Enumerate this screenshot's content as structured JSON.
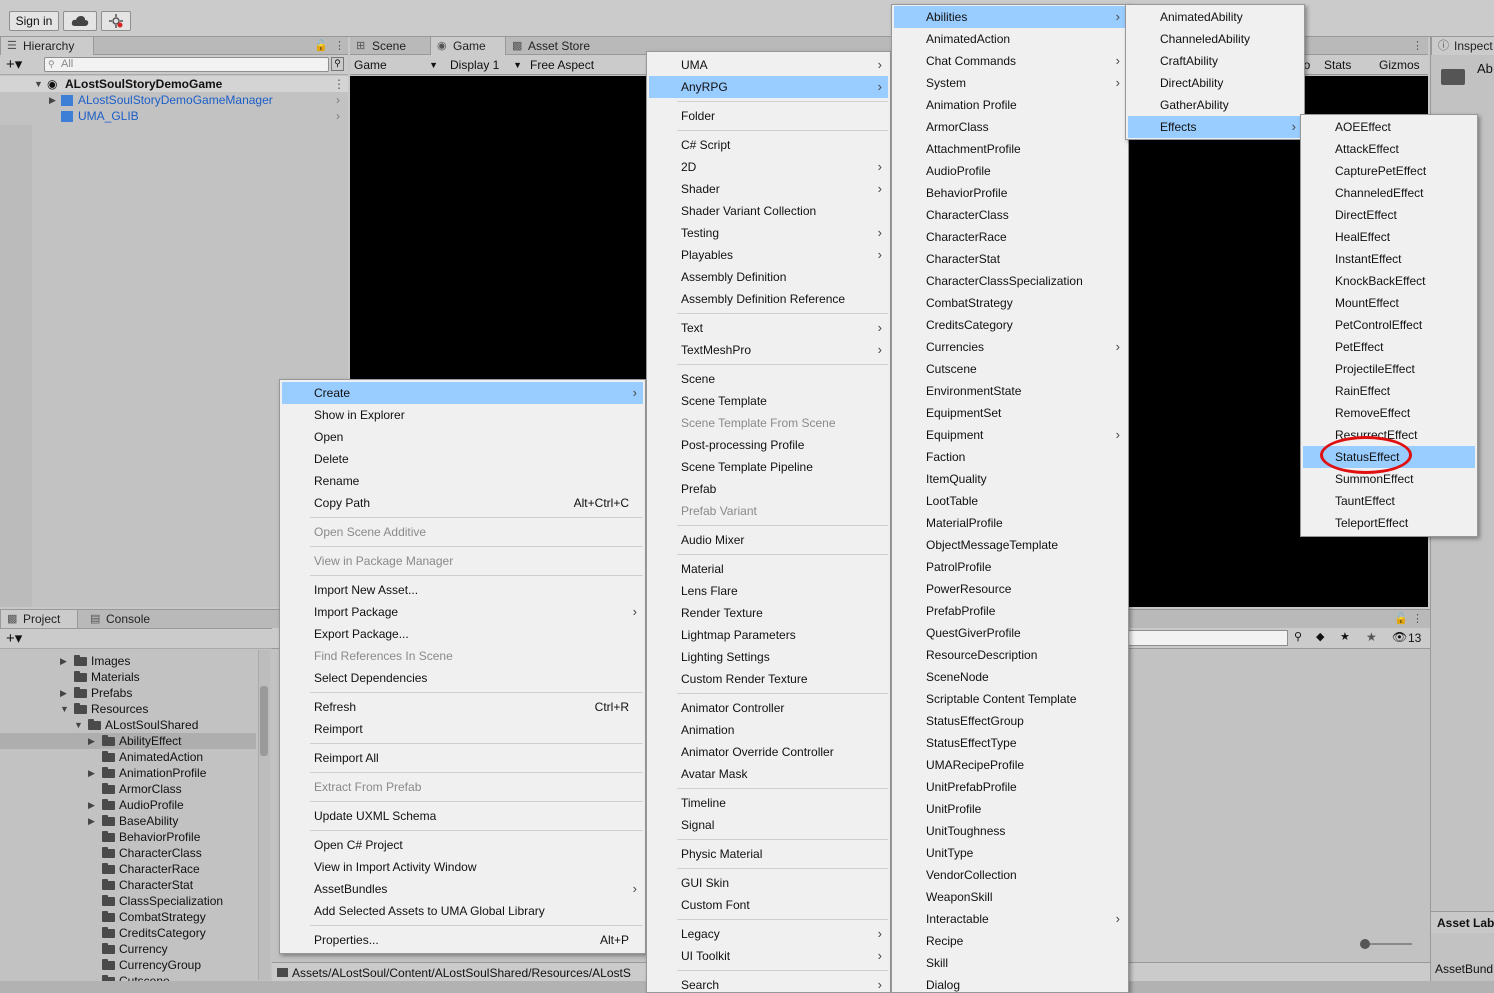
{
  "toolbar": {
    "signin_label": "Sign in",
    "cloud_icon": "cloud-icon",
    "collab_icon": "collab-icon"
  },
  "hierarchy": {
    "tab_label": "Hierarchy",
    "search_placeholder": "All",
    "scene_name": "ALostSoulStoryDemoGame",
    "children": [
      "ALostSoulStoryDemoGameManager",
      "UMA_GLIB"
    ]
  },
  "gameview": {
    "tabs": [
      "Scene",
      "Game",
      "Asset Store"
    ],
    "game_dropdown": "Game",
    "display_dropdown": "Display 1",
    "aspect_dropdown": "Free Aspect",
    "stats_label": "Stats",
    "gizmos_label": "Gizmos",
    "partial_label": "io"
  },
  "inspector": {
    "tab_label": "Inspect",
    "partial_label": "Ab",
    "asset_labels": "Asset Lab",
    "asset_bundle": "AssetBund"
  },
  "project": {
    "tabs": [
      "Project",
      "Console"
    ],
    "tree": [
      {
        "label": "Images",
        "expand": true,
        "indent": 1
      },
      {
        "label": "Materials",
        "expand": false,
        "indent": 1
      },
      {
        "label": "Prefabs",
        "expand": true,
        "indent": 1
      },
      {
        "label": "Resources",
        "expand": true,
        "open": true,
        "indent": 1
      },
      {
        "label": "ALostSoulShared",
        "expand": true,
        "open": true,
        "indent": 2
      },
      {
        "label": "AbilityEffect",
        "expand": true,
        "indent": 3,
        "selected": true
      },
      {
        "label": "AnimatedAction",
        "expand": false,
        "indent": 3
      },
      {
        "label": "AnimationProfile",
        "expand": true,
        "indent": 3
      },
      {
        "label": "ArmorClass",
        "expand": false,
        "indent": 3
      },
      {
        "label": "AudioProfile",
        "expand": true,
        "indent": 3
      },
      {
        "label": "BaseAbility",
        "expand": true,
        "indent": 3
      },
      {
        "label": "BehaviorProfile",
        "expand": false,
        "indent": 3
      },
      {
        "label": "CharacterClass",
        "expand": false,
        "indent": 3
      },
      {
        "label": "CharacterRace",
        "expand": false,
        "indent": 3
      },
      {
        "label": "CharacterStat",
        "expand": false,
        "indent": 3
      },
      {
        "label": "ClassSpecialization",
        "expand": false,
        "indent": 3
      },
      {
        "label": "CombatStrategy",
        "expand": false,
        "indent": 3
      },
      {
        "label": "CreditsCategory",
        "expand": false,
        "indent": 3
      },
      {
        "label": "Currency",
        "expand": false,
        "indent": 3
      },
      {
        "label": "CurrencyGroup",
        "expand": false,
        "indent": 3
      },
      {
        "label": "Cutscene",
        "expand": false,
        "indent": 3
      }
    ],
    "path": "Assets/ALostSoul/Content/ALostSoulShared/Resources/ALostS",
    "hidden_count": "13"
  },
  "menu_main": [
    {
      "label": "Create",
      "sub": true,
      "hl": true
    },
    {
      "label": "Show in Explorer"
    },
    {
      "label": "Open"
    },
    {
      "label": "Delete"
    },
    {
      "label": "Rename"
    },
    {
      "label": "Copy Path",
      "sc": "Alt+Ctrl+C"
    },
    {
      "sep": true
    },
    {
      "label": "Open Scene Additive",
      "dis": true
    },
    {
      "sep": true
    },
    {
      "label": "View in Package Manager",
      "dis": true
    },
    {
      "sep": true
    },
    {
      "label": "Import New Asset..."
    },
    {
      "label": "Import Package",
      "sub": true
    },
    {
      "label": "Export Package..."
    },
    {
      "label": "Find References In Scene",
      "dis": true
    },
    {
      "label": "Select Dependencies"
    },
    {
      "sep": true
    },
    {
      "label": "Refresh",
      "sc": "Ctrl+R"
    },
    {
      "label": "Reimport"
    },
    {
      "sep": true
    },
    {
      "label": "Reimport All"
    },
    {
      "sep": true
    },
    {
      "label": "Extract From Prefab",
      "dis": true
    },
    {
      "sep": true
    },
    {
      "label": "Update UXML Schema"
    },
    {
      "sep": true
    },
    {
      "label": "Open C# Project"
    },
    {
      "label": "View in Import Activity Window"
    },
    {
      "label": "AssetBundles",
      "sub": true
    },
    {
      "label": "Add Selected Assets to UMA Global Library"
    },
    {
      "sep": true
    },
    {
      "label": "Properties...",
      "sc": "Alt+P"
    }
  ],
  "menu_create": [
    {
      "label": "UMA",
      "sub": true
    },
    {
      "label": "AnyRPG",
      "sub": true,
      "hl": true
    },
    {
      "sep": true
    },
    {
      "label": "Folder"
    },
    {
      "sep": true
    },
    {
      "label": "C# Script"
    },
    {
      "label": "2D",
      "sub": true
    },
    {
      "label": "Shader",
      "sub": true
    },
    {
      "label": "Shader Variant Collection"
    },
    {
      "label": "Testing",
      "sub": true
    },
    {
      "label": "Playables",
      "sub": true
    },
    {
      "label": "Assembly Definition"
    },
    {
      "label": "Assembly Definition Reference"
    },
    {
      "sep": true
    },
    {
      "label": "Text",
      "sub": true
    },
    {
      "label": "TextMeshPro",
      "sub": true
    },
    {
      "sep": true
    },
    {
      "label": "Scene"
    },
    {
      "label": "Scene Template"
    },
    {
      "label": "Scene Template From Scene",
      "dis": true
    },
    {
      "label": "Post-processing Profile"
    },
    {
      "label": "Scene Template Pipeline"
    },
    {
      "label": "Prefab"
    },
    {
      "label": "Prefab Variant",
      "dis": true
    },
    {
      "sep": true
    },
    {
      "label": "Audio Mixer"
    },
    {
      "sep": true
    },
    {
      "label": "Material"
    },
    {
      "label": "Lens Flare"
    },
    {
      "label": "Render Texture"
    },
    {
      "label": "Lightmap Parameters"
    },
    {
      "label": "Lighting Settings"
    },
    {
      "label": "Custom Render Texture"
    },
    {
      "sep": true
    },
    {
      "label": "Animator Controller"
    },
    {
      "label": "Animation"
    },
    {
      "label": "Animator Override Controller"
    },
    {
      "label": "Avatar Mask"
    },
    {
      "sep": true
    },
    {
      "label": "Timeline"
    },
    {
      "label": "Signal"
    },
    {
      "sep": true
    },
    {
      "label": "Physic Material"
    },
    {
      "sep": true
    },
    {
      "label": "GUI Skin"
    },
    {
      "label": "Custom Font"
    },
    {
      "sep": true
    },
    {
      "label": "Legacy",
      "sub": true
    },
    {
      "label": "UI Toolkit",
      "sub": true
    },
    {
      "sep": true
    },
    {
      "label": "Search",
      "sub": true
    }
  ],
  "menu_anyrpg": [
    {
      "label": "Abilities",
      "sub": true,
      "hl": true
    },
    {
      "label": "AnimatedAction"
    },
    {
      "label": "Chat Commands",
      "sub": true
    },
    {
      "label": "System",
      "sub": true
    },
    {
      "label": "Animation Profile"
    },
    {
      "label": "ArmorClass"
    },
    {
      "label": "AttachmentProfile"
    },
    {
      "label": "AudioProfile"
    },
    {
      "label": "BehaviorProfile"
    },
    {
      "label": "CharacterClass"
    },
    {
      "label": "CharacterRace"
    },
    {
      "label": "CharacterStat"
    },
    {
      "label": "CharacterClassSpecialization"
    },
    {
      "label": "CombatStrategy"
    },
    {
      "label": "CreditsCategory"
    },
    {
      "label": "Currencies",
      "sub": true
    },
    {
      "label": "Cutscene"
    },
    {
      "label": "EnvironmentState"
    },
    {
      "label": "EquipmentSet"
    },
    {
      "label": "Equipment",
      "sub": true
    },
    {
      "label": "Faction"
    },
    {
      "label": "ItemQuality"
    },
    {
      "label": "LootTable"
    },
    {
      "label": "MaterialProfile"
    },
    {
      "label": "ObjectMessageTemplate"
    },
    {
      "label": "PatrolProfile"
    },
    {
      "label": "PowerResource"
    },
    {
      "label": "PrefabProfile"
    },
    {
      "label": "QuestGiverProfile"
    },
    {
      "label": "ResourceDescription"
    },
    {
      "label": "SceneNode"
    },
    {
      "label": "Scriptable Content Template"
    },
    {
      "label": "StatusEffectGroup"
    },
    {
      "label": "StatusEffectType"
    },
    {
      "label": "UMARecipeProfile"
    },
    {
      "label": "UnitPrefabProfile"
    },
    {
      "label": "UnitProfile"
    },
    {
      "label": "UnitToughness"
    },
    {
      "label": "UnitType"
    },
    {
      "label": "VendorCollection"
    },
    {
      "label": "WeaponSkill"
    },
    {
      "label": "Interactable",
      "sub": true
    },
    {
      "label": "Recipe"
    },
    {
      "label": "Skill"
    },
    {
      "label": "Dialog"
    }
  ],
  "menu_abilities": [
    {
      "label": "AnimatedAbility"
    },
    {
      "label": "ChanneledAbility"
    },
    {
      "label": "CraftAbility"
    },
    {
      "label": "DirectAbility"
    },
    {
      "label": "GatherAbility"
    },
    {
      "label": "Effects",
      "sub": true,
      "hl": true
    }
  ],
  "menu_effects": [
    {
      "label": "AOEEffect"
    },
    {
      "label": "AttackEffect"
    },
    {
      "label": "CapturePetEffect"
    },
    {
      "label": "ChanneledEffect"
    },
    {
      "label": "DirectEffect"
    },
    {
      "label": "HealEffect"
    },
    {
      "label": "InstantEffect"
    },
    {
      "label": "KnockBackEffect"
    },
    {
      "label": "MountEffect"
    },
    {
      "label": "PetControlEffect"
    },
    {
      "label": "PetEffect"
    },
    {
      "label": "ProjectileEffect"
    },
    {
      "label": "RainEffect"
    },
    {
      "label": "RemoveEffect"
    },
    {
      "label": "ResurrectEffect"
    },
    {
      "label": "StatusEffect",
      "hl": true
    },
    {
      "label": "SummonEffect"
    },
    {
      "label": "TauntEffect"
    },
    {
      "label": "TeleportEffect"
    }
  ],
  "colors": {
    "menu_highlight": "#99ccff",
    "annotation_circle": "#e01010",
    "link_blue": "#1c5fc9"
  }
}
